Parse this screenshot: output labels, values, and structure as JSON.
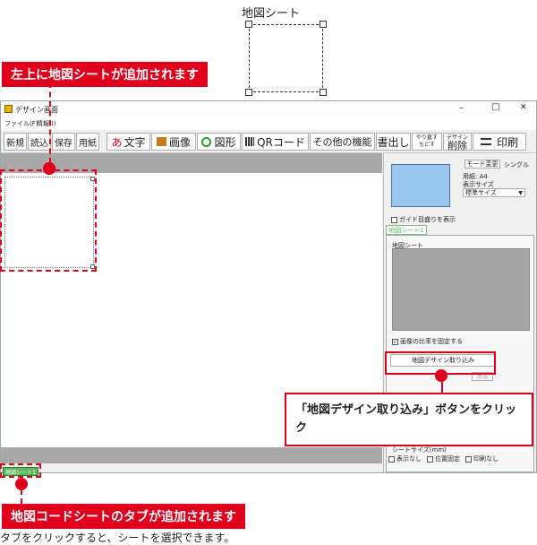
{
  "illustration": {
    "title": "地図シート"
  },
  "callouts": {
    "top_left": "左上に地図シートが追加されます",
    "import_button": "「地図デザイン取り込み」ボタンをクリック",
    "tab_added": "地図コードシートのタブが追加されます",
    "footer_note": "タブをクリックすると、シートを選択できます。"
  },
  "window": {
    "title": "デザイン画面",
    "controls": {
      "minimize": "–",
      "maximize": "□",
      "close": "✕"
    },
    "menu": [
      "ファイル(F)",
      "情報(I)"
    ],
    "toolbar": {
      "new": "新規",
      "open": "読込",
      "save": "保存",
      "paper": "用紙",
      "text_icon": "あ",
      "text": "文字",
      "image": "画像",
      "shape": "図形",
      "qr": "QRコード",
      "other": "その他の機能",
      "export": "書出し",
      "undo": "やり直す",
      "redo": "もどす",
      "design_small": "デザイン",
      "delete": "削除",
      "print": "印刷"
    },
    "bottom_tab": "地図シート1"
  },
  "panel": {
    "mode_button": "モード変更",
    "mode_value": "シングル",
    "paper_label": "用紙: A4",
    "display_size_label": "表示サイズ",
    "display_size_value": "標準サイズ",
    "guide_checkbox": "ガイド目盛りを表示",
    "sheet_tab": "地図シート1",
    "sheet_group": "地図シート",
    "fix_ratio": "画像の比率を固定する",
    "import_button": "地図デザイン取り込み",
    "erase_button": "消去",
    "sheet_size_label": "シートサイズ(mm)",
    "hide_label": "表示なし",
    "lock_position": "位置固定",
    "no_print": "印刷なし"
  },
  "colors": {
    "accent_red": "#e0001b",
    "preview_blue": "#98c6ee",
    "tab_green": "#5cb85c"
  }
}
